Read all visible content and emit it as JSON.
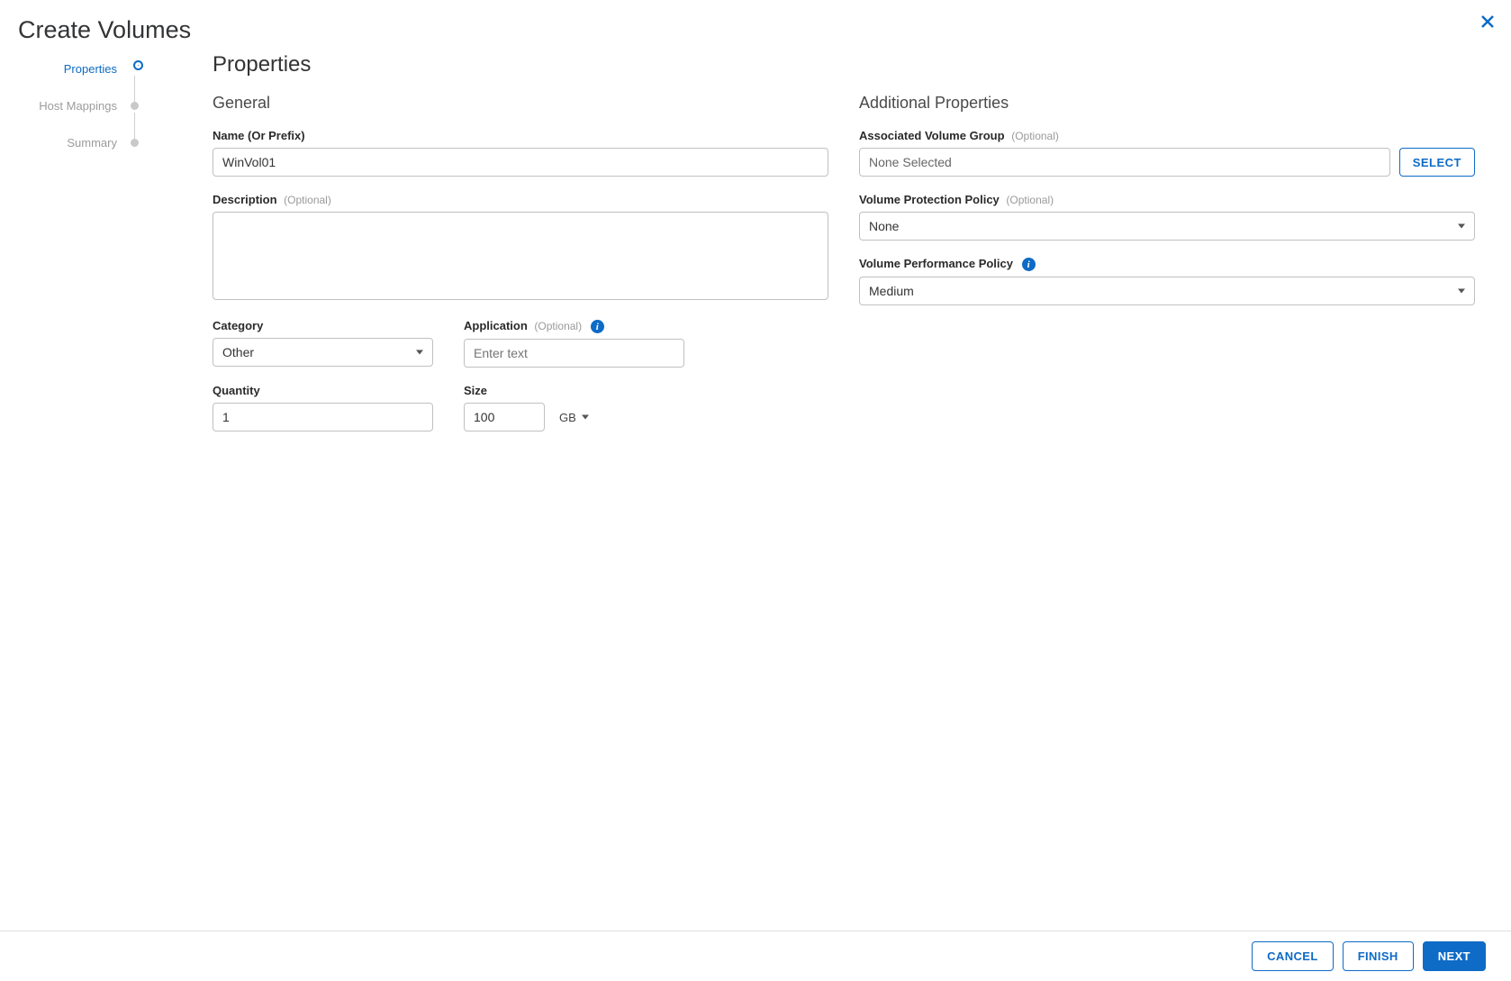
{
  "modal": {
    "title": "Create Volumes"
  },
  "stepper": {
    "items": [
      {
        "label": "Properties",
        "active": true
      },
      {
        "label": "Host Mappings",
        "active": false
      },
      {
        "label": "Summary",
        "active": false
      }
    ]
  },
  "page": {
    "title": "Properties"
  },
  "general": {
    "section_title": "General",
    "name_label": "Name (Or Prefix)",
    "name_value": "WinVol01",
    "description_label": "Description",
    "description_optional": "(Optional)",
    "description_value": "",
    "category_label": "Category",
    "category_value": "Other",
    "application_label": "Application",
    "application_optional": "(Optional)",
    "application_placeholder": "Enter text",
    "application_value": "",
    "quantity_label": "Quantity",
    "quantity_value": "1",
    "size_label": "Size",
    "size_value": "100",
    "size_unit": "GB"
  },
  "additional": {
    "section_title": "Additional Properties",
    "volume_group_label": "Associated Volume Group",
    "volume_group_optional": "(Optional)",
    "volume_group_value": "None Selected",
    "select_button": "SELECT",
    "protection_label": "Volume Protection Policy",
    "protection_optional": "(Optional)",
    "protection_value": "None",
    "performance_label": "Volume Performance Policy",
    "performance_value": "Medium"
  },
  "footer": {
    "cancel": "CANCEL",
    "finish": "FINISH",
    "next": "NEXT"
  }
}
